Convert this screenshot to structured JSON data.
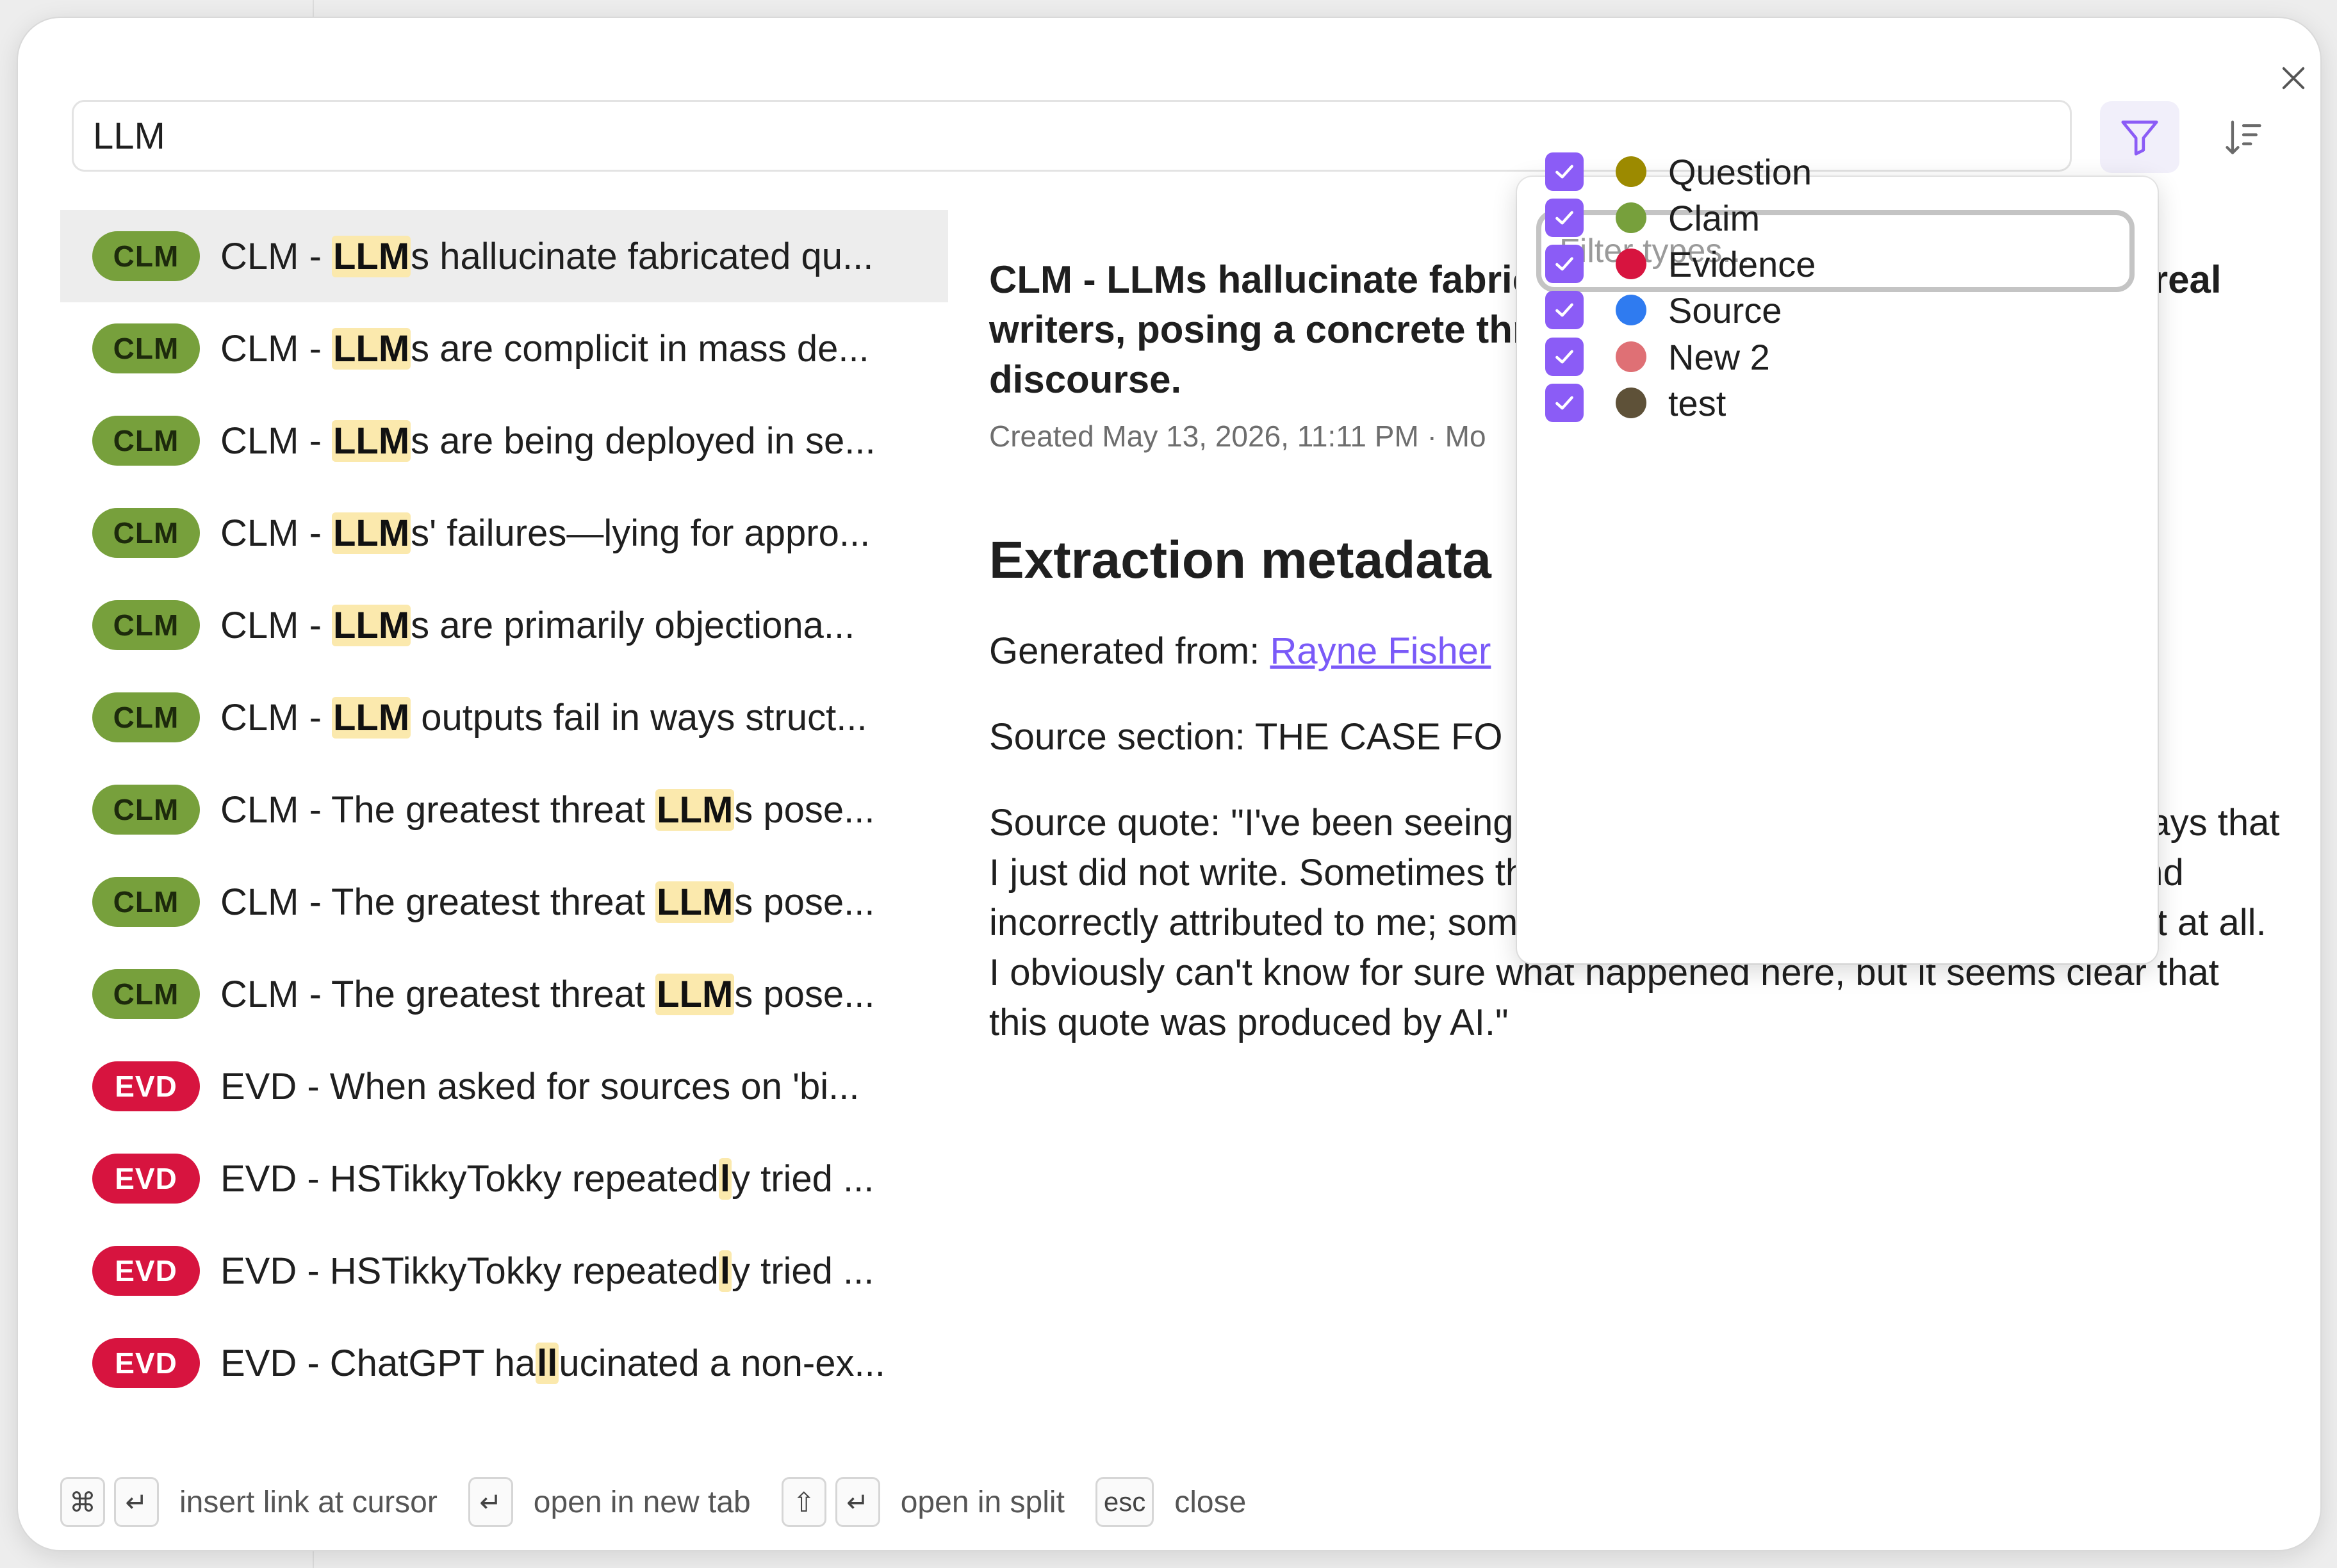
{
  "search": {
    "value": "LLM"
  },
  "filter": {
    "placeholder": "Filter types..."
  },
  "types": [
    {
      "label": "Question",
      "color": "#9c8a00",
      "checked": true
    },
    {
      "label": "Claim",
      "color": "#77a03c",
      "checked": true
    },
    {
      "label": "Evidence",
      "color": "#d7143f",
      "checked": true
    },
    {
      "label": "Source",
      "color": "#2f7bf0",
      "checked": true
    },
    {
      "label": "New 2",
      "color": "#df7075",
      "checked": true
    },
    {
      "label": "test",
      "color": "#5e5138",
      "checked": true
    }
  ],
  "results": [
    {
      "badge": "CLM",
      "pre": "CLM - ",
      "hl": "LLM",
      "post": "s hallucinate fabricated qu..."
    },
    {
      "badge": "CLM",
      "pre": "CLM - ",
      "hl": "LLM",
      "post": "s are complicit in mass de..."
    },
    {
      "badge": "CLM",
      "pre": "CLM - ",
      "hl": "LLM",
      "post": "s are being deployed in se..."
    },
    {
      "badge": "CLM",
      "pre": "CLM - ",
      "hl": "LLM",
      "post": "s' failures—lying for appro..."
    },
    {
      "badge": "CLM",
      "pre": "CLM - ",
      "hl": "LLM",
      "post": "s are primarily objectiona..."
    },
    {
      "badge": "CLM",
      "pre": "CLM - ",
      "hl": "LLM",
      "post": " outputs fail in ways struct..."
    },
    {
      "badge": "CLM",
      "pre": "CLM - The greatest threat ",
      "hl": "LLM",
      "post": "s pose..."
    },
    {
      "badge": "CLM",
      "pre": "CLM - The greatest threat ",
      "hl": "LLM",
      "post": "s pose..."
    },
    {
      "badge": "CLM",
      "pre": "CLM - The greatest threat ",
      "hl": "LLM",
      "post": "s pose..."
    },
    {
      "badge": "EVD",
      "pre": "EVD - When asked for sources on 'bi...",
      "hl": "",
      "post": ""
    },
    {
      "badge": "EVD",
      "pre": "EVD - HSTikkyTokky repeated",
      "hl": "l",
      "post": "y tried ..."
    },
    {
      "badge": "EVD",
      "pre": "EVD - HSTikkyTokky repeated",
      "hl": "l",
      "post": "y tried ..."
    },
    {
      "badge": "EVD",
      "pre": "EVD - ChatGPT ha",
      "hl": "ll",
      "post": "ucinated a non-ex..."
    }
  ],
  "preview": {
    "title": "CLM - LLMs hallucinate fabricated quotes and attribute them to real writers, posing a concrete threat to the integrity of intellectual discourse.",
    "meta": "Created May 13, 2026, 11:11 PM · Mo",
    "heading": "Extraction metadata",
    "generated_label": "Generated from: ",
    "generated_link": "Rayne Fisher",
    "section": "Source section: THE CASE FO",
    "quote": "Source quote: \"I've been seeing quotes in my name from talks and essays that I just did not write. Sometimes they've been written by another writer and incorrectly attributed to me; sometimes, like in this case, they don't exist at all. I obviously can't know for sure what happened here, but it seems clear that this quote was produced by AI.\""
  },
  "footer": {
    "insert_link": "insert link at cursor",
    "new_tab": "open in new tab",
    "split": "open in split",
    "esc_key": "esc",
    "close": "close",
    "cmd_key": "⌘",
    "enter_key": "↵",
    "shift_key": "⇧"
  }
}
